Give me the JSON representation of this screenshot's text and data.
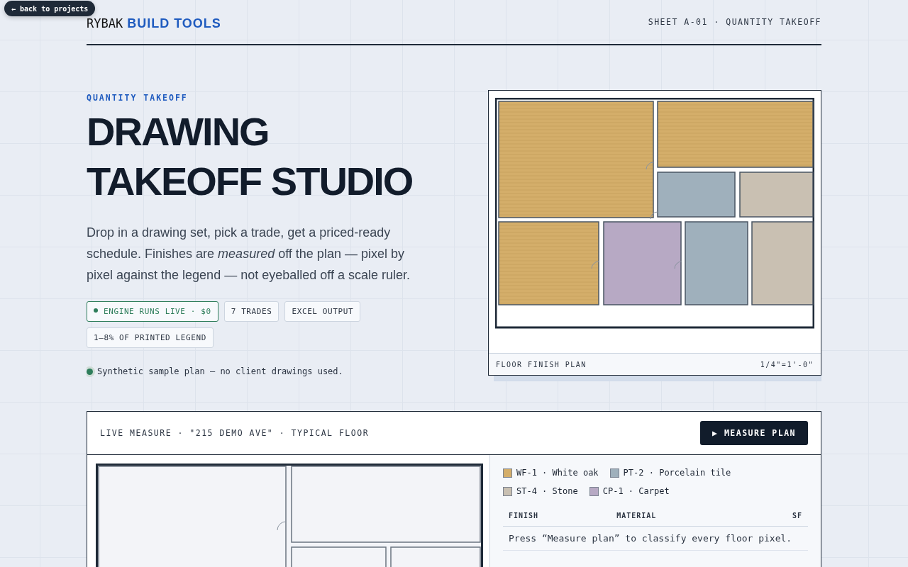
{
  "nav": {
    "back_button": "← back to projects"
  },
  "header": {
    "brand": "RYBAK",
    "brand_accent": "BUILD TOOLS",
    "sheet": "SHEET A-01 · QUANTITY TAKEOFF"
  },
  "hero": {
    "eyebrow": "QUANTITY TAKEOFF",
    "title_lines": [
      "DRAWING",
      "TAKEOFF STUDIO"
    ],
    "lede": "Drop in a drawing set, pick a trade, get a priced-ready schedule. Finishes are *measured* off the plan — pixel by pixel against the legend — not eyeballed off a scale ruler.",
    "badges": [
      {
        "label": "ENGINE RUNS LIVE · $0",
        "kind": "live"
      },
      {
        "label": "7 TRADES",
        "kind": "plain"
      },
      {
        "label": "EXCEL OUTPUT",
        "kind": "plain"
      },
      {
        "label": "1–8% OF PRINTED LEGEND",
        "kind": "plain"
      }
    ],
    "note": "Synthetic sample plan — no client drawings used."
  },
  "plan_figure": {
    "caption": "FLOOR FINISH PLAN",
    "scale": "1/4\"=1'-0\"",
    "rooms": [
      {
        "kind": "wood",
        "color": "#d4ae6a"
      },
      {
        "kind": "wood",
        "color": "#d4ae6a"
      },
      {
        "kind": "flat",
        "color": "#9fb0bc"
      },
      {
        "kind": "flat",
        "color": "#c9c0b2"
      },
      {
        "kind": "wood",
        "color": "#d4ae6a"
      },
      {
        "kind": "flat",
        "color": "#b7a9c4"
      },
      {
        "kind": "flat",
        "color": "#9fb0bc"
      },
      {
        "kind": "flat",
        "color": "#c9c0b2"
      }
    ]
  },
  "measure": {
    "title": "LIVE MEASURE · \"215 DEMO AVE\" · TYPICAL FLOOR",
    "button": "▶ MEASURE PLAN",
    "legend": [
      {
        "label": "WF-1 · White oak",
        "color": "#d4ae6a"
      },
      {
        "label": "PT-2 · Porcelain tile",
        "color": "#9fb0bc"
      },
      {
        "label": "ST-4 · Stone",
        "color": "#c9c0b2"
      },
      {
        "label": "CP-1 · Carpet",
        "color": "#b7a9c4"
      }
    ],
    "table": {
      "columns": [
        "FINISH",
        "MATERIAL",
        "SF"
      ],
      "empty_message": "Press “Measure plan” to classify every floor pixel."
    }
  }
}
